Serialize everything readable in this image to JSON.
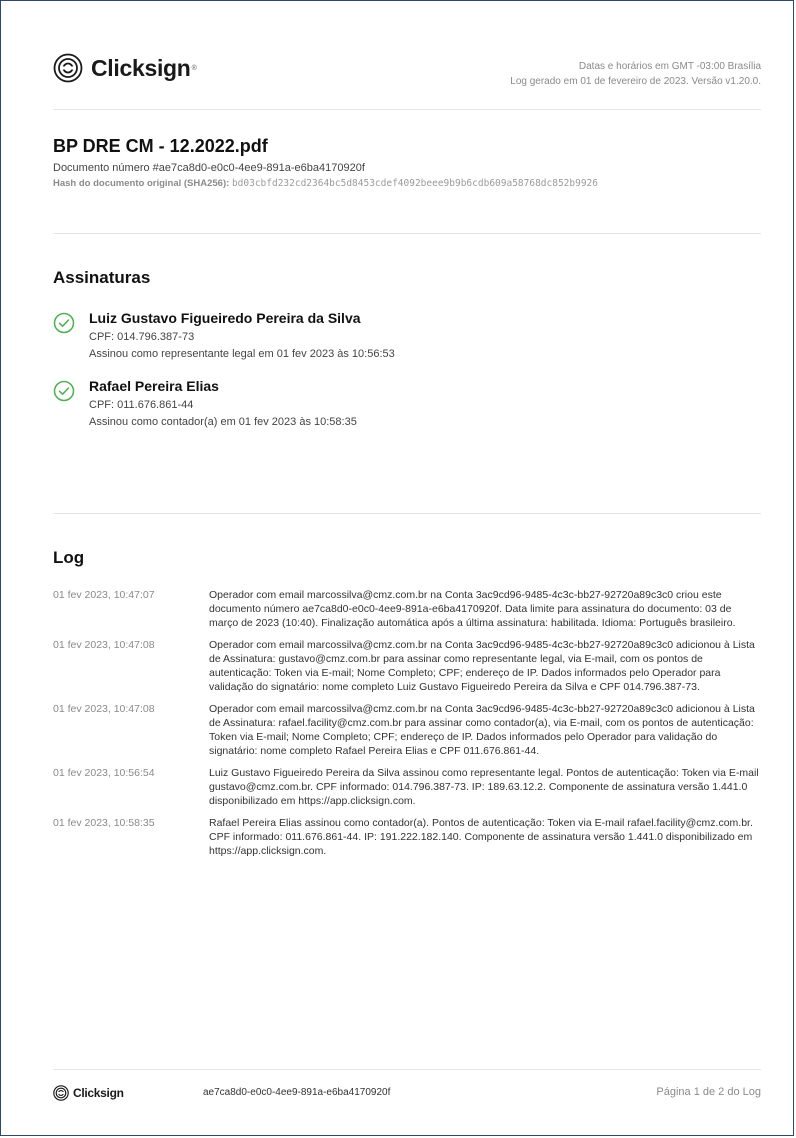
{
  "header": {
    "brand": "Clicksign",
    "timezone_note": "Datas e horários em GMT -03:00 Brasília",
    "log_info": "Log gerado em 01 de fevereiro de 2023. Versão v1.20.0."
  },
  "document": {
    "title": "BP DRE CM - 12.2022.pdf",
    "number": "Documento número #ae7ca8d0-e0c0-4ee9-891a-e6ba4170920f",
    "hash_label": "Hash do documento original (SHA256):",
    "hash_value": "bd03cbfd232cd2364bc5d8453cdef4092beee9b9b6cdb609a58768dc852b9926"
  },
  "signatures": {
    "title": "Assinaturas",
    "items": [
      {
        "name": "Luiz Gustavo Figueiredo Pereira da Silva",
        "cpf": "CPF: 014.796.387-73",
        "signed": "Assinou como representante legal em 01 fev 2023 às 10:56:53"
      },
      {
        "name": "Rafael Pereira Elias",
        "cpf": "CPF: 011.676.861-44",
        "signed": "Assinou como contador(a) em 01 fev 2023 às 10:58:35"
      }
    ]
  },
  "log": {
    "title": "Log",
    "entries": [
      {
        "time": "01 fev 2023, 10:47:07",
        "text": "Operador com email marcossilva@cmz.com.br na Conta 3ac9cd96-9485-4c3c-bb27-92720a89c3c0 criou este documento número ae7ca8d0-e0c0-4ee9-891a-e6ba4170920f. Data limite para assinatura do documento: 03 de março de 2023 (10:40). Finalização automática após a última assinatura: habilitada. Idioma: Português brasileiro."
      },
      {
        "time": "01 fev 2023, 10:47:08",
        "text": "Operador com email marcossilva@cmz.com.br na Conta 3ac9cd96-9485-4c3c-bb27-92720a89c3c0 adicionou à Lista de Assinatura: gustavo@cmz.com.br para assinar como representante legal, via E-mail, com os pontos de autenticação: Token via E-mail; Nome Completo; CPF; endereço de IP. Dados informados pelo Operador para validação do signatário: nome completo Luiz Gustavo Figueiredo Pereira da Silva e CPF 014.796.387-73."
      },
      {
        "time": "01 fev 2023, 10:47:08",
        "text": "Operador com email marcossilva@cmz.com.br na Conta 3ac9cd96-9485-4c3c-bb27-92720a89c3c0 adicionou à Lista de Assinatura: rafael.facility@cmz.com.br para assinar como contador(a), via E-mail, com os pontos de autenticação: Token via E-mail; Nome Completo; CPF; endereço de IP. Dados informados pelo Operador para validação do signatário: nome completo Rafael Pereira Elias e CPF 011.676.861-44."
      },
      {
        "time": "01 fev 2023, 10:56:54",
        "text": "Luiz Gustavo Figueiredo Pereira da Silva assinou como representante legal. Pontos de autenticação: Token via E-mail gustavo@cmz.com.br. CPF informado: 014.796.387-73. IP: 189.63.12.2. Componente de assinatura versão 1.441.0 disponibilizado em https://app.clicksign.com."
      },
      {
        "time": "01 fev 2023, 10:58:35",
        "text": "Rafael Pereira Elias assinou como contador(a). Pontos de autenticação: Token via E-mail rafael.facility@cmz.com.br. CPF informado: 011.676.861-44. IP: 191.222.182.140. Componente de assinatura versão 1.441.0 disponibilizado em https://app.clicksign.com."
      }
    ]
  },
  "footer": {
    "brand": "Clicksign",
    "hash": "ae7ca8d0-e0c0-4ee9-891a-e6ba4170920f",
    "page": "Página 1 de 2 do Log"
  },
  "colors": {
    "check_green": "#4caf50",
    "border": "#2e4a6b"
  }
}
